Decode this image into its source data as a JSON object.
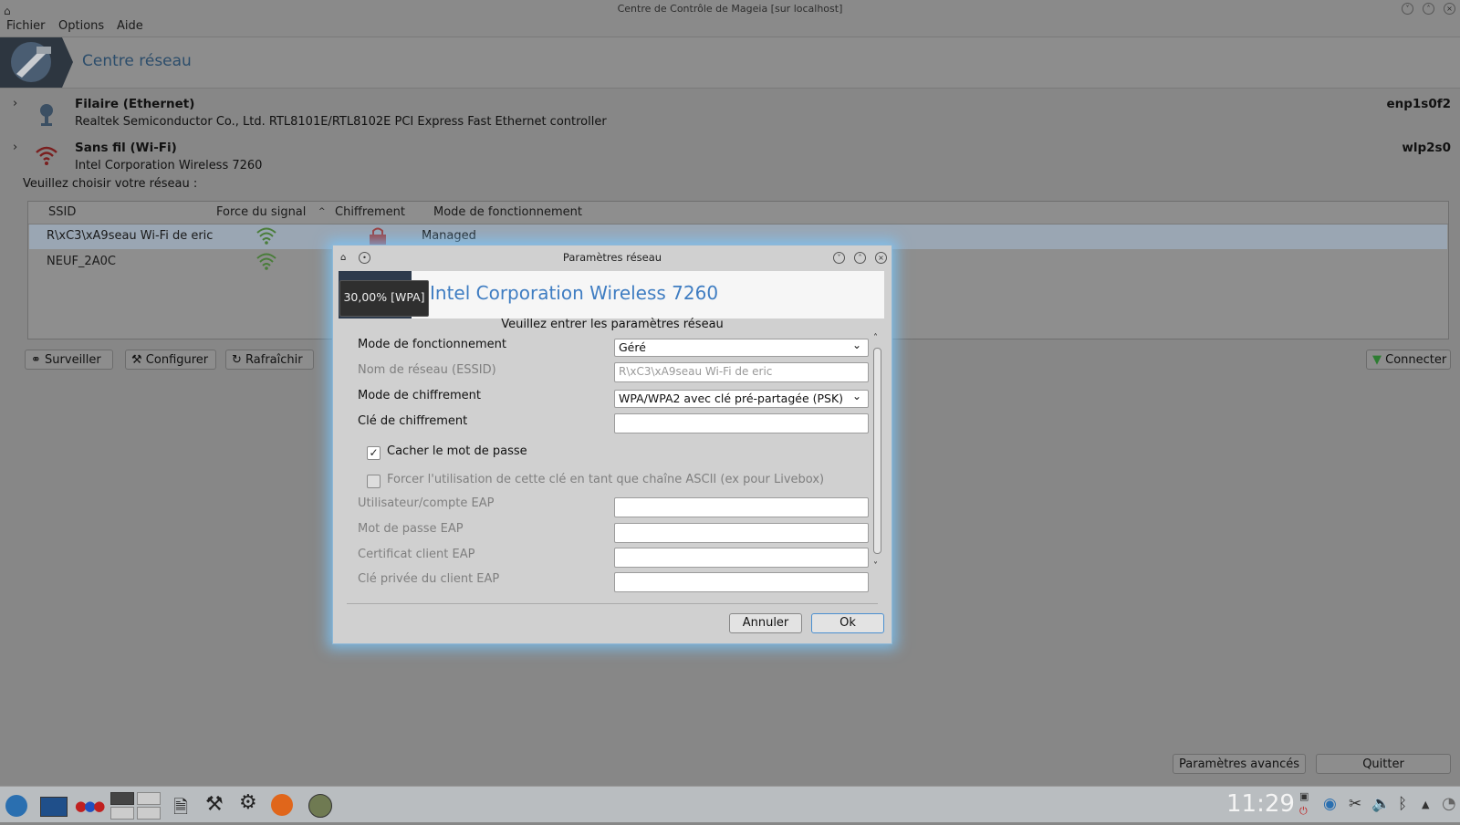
{
  "window": {
    "title": "Centre de Contrôle de Mageia  [sur localhost]"
  },
  "menu": {
    "file": "Fichier",
    "options": "Options",
    "help": "Aide"
  },
  "banner": {
    "title": "Centre réseau"
  },
  "interfaces": [
    {
      "name": "Filaire (Ethernet)",
      "desc": "Realtek Semiconductor Co., Ltd. RTL8101E/RTL8102E PCI Express Fast Ethernet controller",
      "id": "enp1s0f2"
    },
    {
      "name": "Sans fil (Wi-Fi)",
      "desc": "Intel Corporation Wireless 7260",
      "id": "wlp2s0"
    }
  ],
  "choose_prompt": "Veuillez choisir votre réseau :",
  "table": {
    "headers": {
      "ssid": "SSID",
      "signal": "Force du signal",
      "encryption": "Chiffrement",
      "mode": "Mode de fonctionnement"
    },
    "rows": [
      {
        "ssid": "R\\xC3\\xA9seau Wi-Fi de eric",
        "mode": "Managed"
      },
      {
        "ssid": "NEUF_2A0C",
        "mode": ""
      }
    ]
  },
  "buttons": {
    "monitor": "Surveiller",
    "configure": "Configurer",
    "refresh": "Rafraîchir",
    "connect": "Connecter",
    "advanced": "Paramètres avancés",
    "quit": "Quitter"
  },
  "dialog": {
    "title": "Paramètres réseau",
    "header": "Intel Corporation Wireless 7260",
    "tooltip": "30,00% [WPA]",
    "prompt": "Veuillez entrer les paramètres réseau",
    "fields": {
      "mode_label": "Mode de fonctionnement",
      "mode_value": "Géré",
      "essid_label": "Nom de réseau (ESSID)",
      "essid_value": "R\\xC3\\xA9seau Wi-Fi de eric",
      "encmode_label": "Mode de chiffrement",
      "encmode_value": "WPA/WPA2 avec clé pré-partagée (PSK)",
      "key_label": "Clé de chiffrement",
      "hide_label": "Cacher le mot de passe",
      "ascii_label": "Forcer l'utilisation de cette clé en tant que chaîne ASCII (ex pour Livebox)",
      "eap_user_label": "Utilisateur/compte EAP",
      "eap_pass_label": "Mot de passe EAP",
      "eap_cert_label": "Certificat client EAP",
      "eap_key_label": "Clé privée du client EAP"
    },
    "cancel": "Annuler",
    "ok": "Ok"
  },
  "taskbar": {
    "clock": "11:29"
  },
  "colors": {
    "accent": "#3f7dc2",
    "dialog_glow": "#78c8ff",
    "selected_row": "#9aa6b3"
  }
}
